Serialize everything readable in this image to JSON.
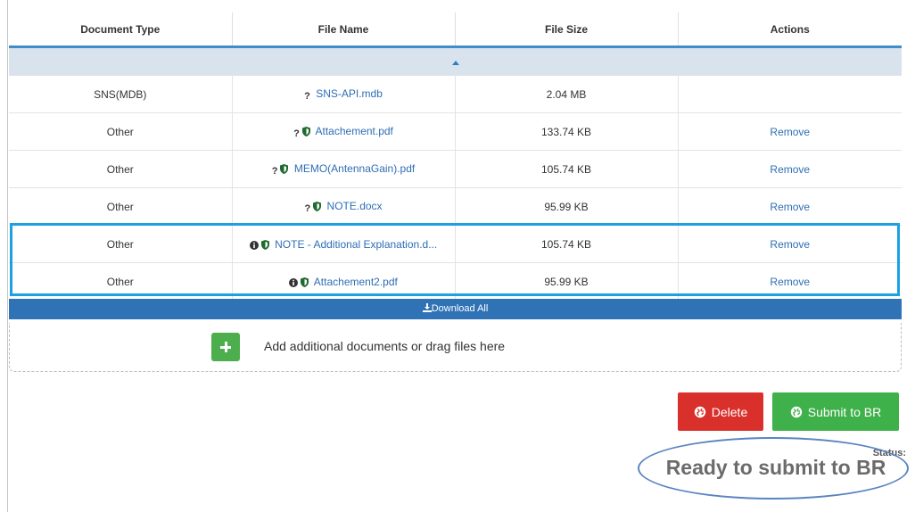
{
  "table": {
    "headers": [
      "Document Type",
      "File Name",
      "File Size",
      "Actions"
    ],
    "rows": [
      {
        "type": "SNS(MDB)",
        "icons": [
          "question"
        ],
        "file": "SNS-API.mdb",
        "size": "2.04 MB",
        "action": ""
      },
      {
        "type": "Other",
        "icons": [
          "question",
          "shield"
        ],
        "file": "Attachement.pdf",
        "size": "133.74 KB",
        "action": "Remove"
      },
      {
        "type": "Other",
        "icons": [
          "question",
          "shield"
        ],
        "file": "MEMO(AntennaGain).pdf",
        "size": "105.74 KB",
        "action": "Remove"
      },
      {
        "type": "Other",
        "icons": [
          "question",
          "shield"
        ],
        "file": "NOTE.docx",
        "size": "95.99 KB",
        "action": "Remove"
      },
      {
        "type": "Other",
        "icons": [
          "info",
          "shield"
        ],
        "file": "NOTE - Additional Explanation.d...",
        "size": "105.74 KB",
        "action": "Remove"
      },
      {
        "type": "Other",
        "icons": [
          "info",
          "shield"
        ],
        "file": "Attachement2.pdf",
        "size": "95.99 KB",
        "action": "Remove"
      }
    ]
  },
  "download_all_label": "Download All",
  "add_documents_text": "Add additional documents or drag files here",
  "delete_label": "Delete",
  "submit_label": "Submit to BR",
  "status_label": "Status:",
  "status_value": "Ready to submit to BR",
  "colors": {
    "header_underline": "#3f8dc9",
    "link": "#2f6eb5",
    "download_bar": "#2f72b5",
    "add_button": "#4cae4c",
    "delete_button": "#d9302c",
    "submit_button": "#3fb14a",
    "highlight_box": "#1ba1e2",
    "status_ellipse": "#5a84c0"
  }
}
